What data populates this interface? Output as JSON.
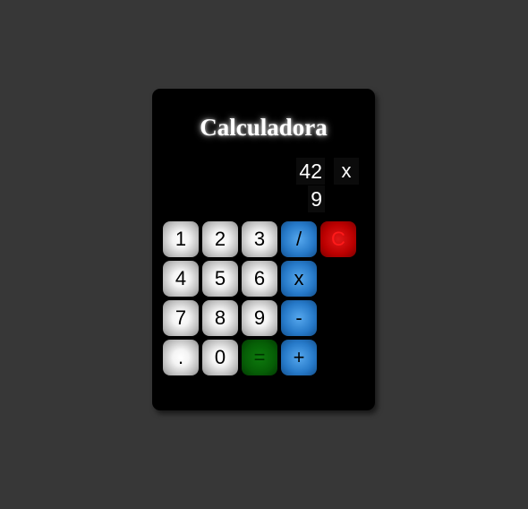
{
  "title": "Calculadora",
  "display": {
    "first_operand": "42",
    "operator": "x",
    "second_operand": "9"
  },
  "keys": {
    "one": "1",
    "two": "2",
    "three": "3",
    "four": "4",
    "five": "5",
    "six": "6",
    "seven": "7",
    "eight": "8",
    "nine": "9",
    "zero": "0",
    "decimal": ".",
    "divide": "/",
    "multiply": "x",
    "subtract": "-",
    "add": "+",
    "equals": "=",
    "clear": "C"
  },
  "colors": {
    "background": "#373737",
    "panel": "#000000",
    "number_key": "#c8c8c8",
    "operator_key": "#2679c8",
    "clear_key": "#bb0000",
    "equals_key": "#065e06"
  }
}
